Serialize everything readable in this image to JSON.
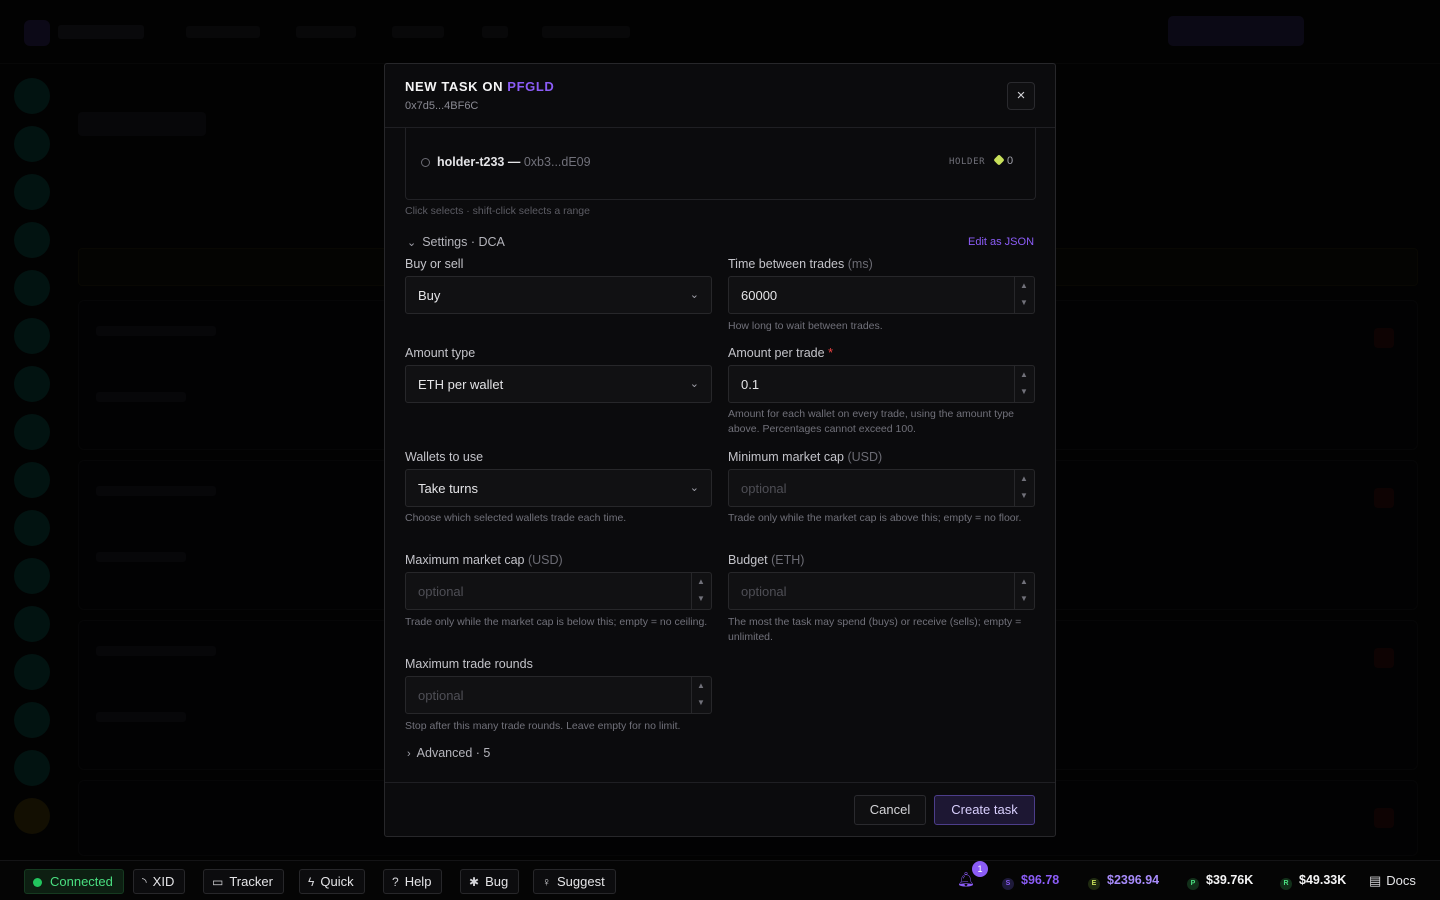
{
  "colors": {
    "accent": "#8b5cf6",
    "required": "#ef4444",
    "connected": "#22c55e",
    "eth_price": "#a78bfa"
  },
  "modal": {
    "title_prefix": "NEW TASK ON",
    "ticker": "PFGLD",
    "token_address": "0x7d5...4BF6C",
    "close_icon": "×"
  },
  "wallet": {
    "name": "holder-t233",
    "separator": "—",
    "address": "0xb3...dE09",
    "role": "HOLDER",
    "balance": "0"
  },
  "wallet_hint": "Click selects · shift-click selects a range",
  "settings": {
    "toggle_label": "Settings · DCA",
    "edit_json": "Edit as JSON"
  },
  "fields": {
    "buy_or_sell": {
      "label": "Buy or sell",
      "value": "Buy"
    },
    "time_between": {
      "label": "Time between trades",
      "unit": "(ms)",
      "value": "60000",
      "help": "How long to wait between trades."
    },
    "amount_type": {
      "label": "Amount type",
      "value": "ETH per wallet"
    },
    "amount_per_trade": {
      "label": "Amount per trade",
      "required": "*",
      "value": "0.1",
      "help": "Amount for each wallet on every trade, using the amount type above. Percentages cannot exceed 100."
    },
    "wallets_to_use": {
      "label": "Wallets to use",
      "value": "Take turns",
      "help": "Choose which selected wallets trade each time."
    },
    "min_market_cap": {
      "label": "Minimum market cap",
      "unit": "(USD)",
      "placeholder": "optional",
      "help": "Trade only while the market cap is above this; empty = no floor."
    },
    "max_market_cap": {
      "label": "Maximum market cap",
      "unit": "(USD)",
      "placeholder": "optional",
      "help": "Trade only while the market cap is below this; empty = no ceiling."
    },
    "budget": {
      "label": "Budget",
      "unit": "(ETH)",
      "placeholder": "optional",
      "help": "The most the task may spend (buys) or receive (sells); empty = unlimited."
    },
    "max_rounds": {
      "label": "Maximum trade rounds",
      "placeholder": "optional",
      "help": "Stop after this many trade rounds. Leave empty for no limit."
    }
  },
  "advanced": {
    "label": "Advanced · 5"
  },
  "footer": {
    "cancel": "Cancel",
    "create": "Create task"
  },
  "statusbar": {
    "connected": "Connected",
    "buttons": [
      "XID",
      "Tracker",
      "Quick",
      "Help",
      "Bug",
      "Suggest"
    ],
    "notifications": "1",
    "tickers": [
      {
        "icon": "S",
        "value": "$96.78",
        "color": "#8b5cf6"
      },
      {
        "icon": "E",
        "value": "$2396.94",
        "color": "#a78bfa"
      },
      {
        "icon": "P",
        "value": "$39.76K",
        "color": "#f4f4f5"
      },
      {
        "icon": "R",
        "value": "$49.33K",
        "color": "#f4f4f5"
      }
    ],
    "docs": "Docs"
  }
}
